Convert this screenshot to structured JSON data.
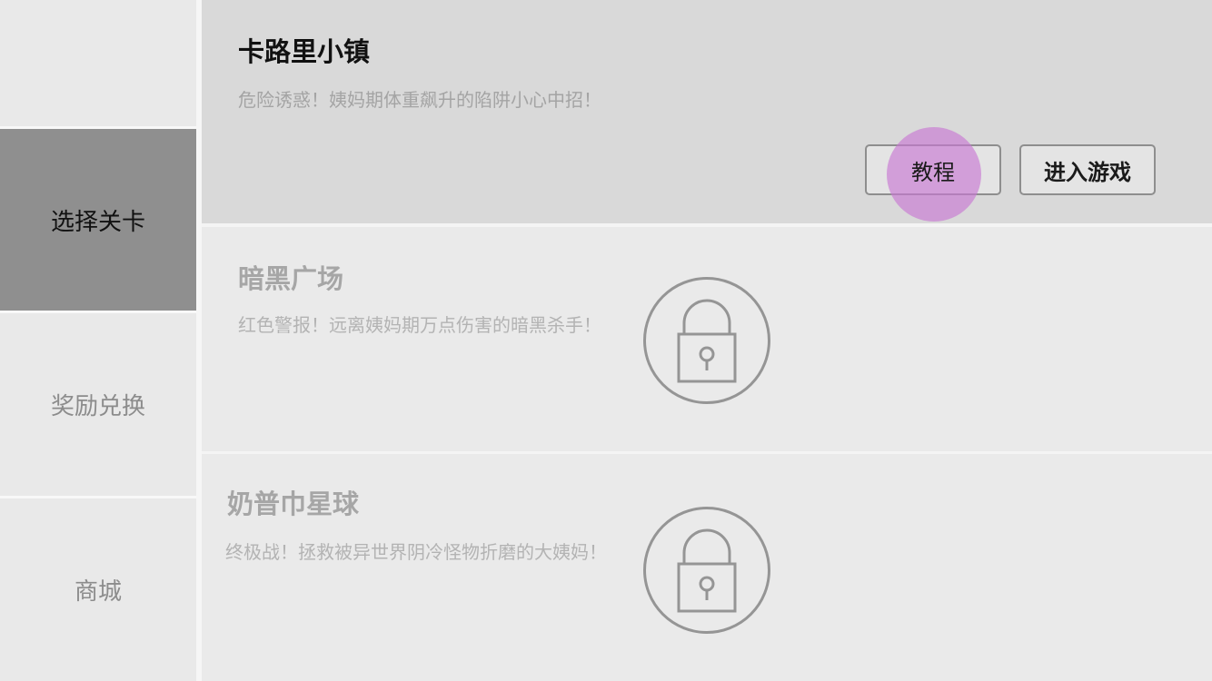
{
  "sidebar": {
    "items": [
      {
        "label": "选择关卡",
        "active": true
      },
      {
        "label": "奖励兑换",
        "active": false
      },
      {
        "label": "商城",
        "active": false
      }
    ]
  },
  "levels": [
    {
      "title": "卡路里小镇",
      "description": "危险诱惑！姨妈期体重飙升的陷阱小心中招！",
      "locked": false,
      "buttons": {
        "tutorial": "教程",
        "enter": "进入游戏"
      }
    },
    {
      "title": "暗黑广场",
      "description": "红色警报！远离姨妈期万点伤害的暗黑杀手！",
      "locked": true,
      "icon": "lock-icon"
    },
    {
      "title": "奶普巾星球",
      "description": "终极战！拯救被异世界阴冷怪物折磨的大姨妈！",
      "locked": true,
      "icon": "lock-icon"
    }
  ],
  "colors": {
    "sidebar_active_bg": "#8f8f8f",
    "sidebar_bg": "#e9e9e9",
    "unlocked_card_bg": "#d9d9d9",
    "locked_card_bg": "#eaeaea",
    "touch_indicator": "#c878d2"
  }
}
